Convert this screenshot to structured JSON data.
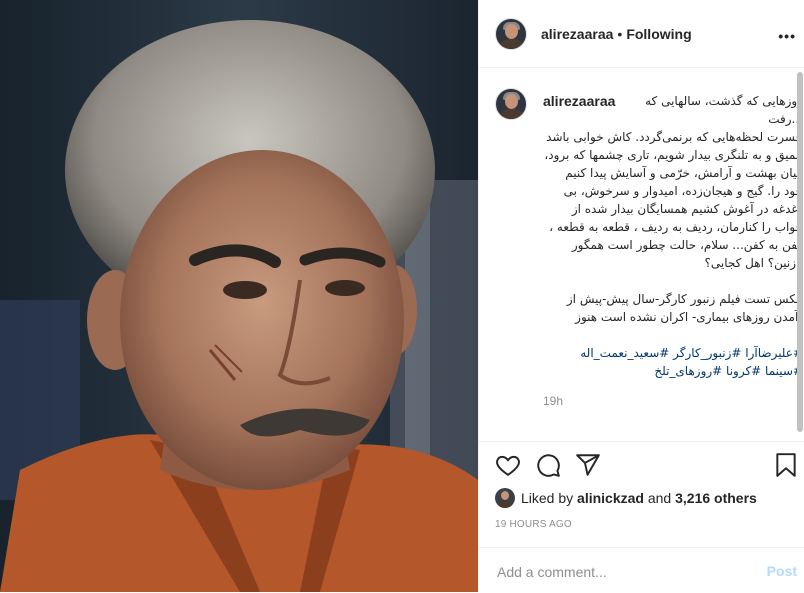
{
  "post": {
    "username": "alirezaaraa",
    "separator": "•",
    "follow_status": "Following",
    "more_glyph": "•••"
  },
  "caption": {
    "username": "alirezaaraa",
    "line1": "روزهایی که گذشت، سالهایی که ...رفت",
    "para1": "حسرت لحظه‌هایی که برنمی‌گردد. کاش خوابی باشد عمیق و به تلنگری بیدار شویم، تاری چشمها که برود، میان بهشت و آرامش، خرّمی و آسایش پیدا کنیم خود را. گیج و هیجان‌زده، امیدوار و سرخوش، بی دغدغه در آغوش کشیم همسایگان بیدار شده از خواب را کنارمان، ردیف به ردیف ، قطعه به قطعه ، کفن به کفن... سلام، حالت چطور است همگور نازنین؟ اهل کجایی؟",
    "dot1": ".",
    "para2": "عکس تست فیلم زنبور کارگر-سال پیش-پیش از (آمدن روزهای بیماری- اکران نشده است هنوز",
    "dot2": ".",
    "hashtags": "#علیرضاآرا #زنبور_کارگر #سعید_نعمت_اله #سینما #کرونا #روزهای_تلخ",
    "time": "19h"
  },
  "actions": {
    "like_icon": "heart-icon",
    "comment_icon": "comment-icon",
    "share_icon": "paper-plane-icon",
    "save_icon": "bookmark-icon"
  },
  "likes": {
    "prefix": "Liked by",
    "user": "alinickzad",
    "middle": "and",
    "count": "3,216 others"
  },
  "timestamp": "19 HOURS AGO",
  "comment_box": {
    "placeholder": "Add a comment...",
    "post_label": "Post",
    "post_color": "#b3dbff"
  },
  "colors": {
    "link": "#00376b",
    "muted": "#8e8e8e",
    "border": "#efefef"
  }
}
